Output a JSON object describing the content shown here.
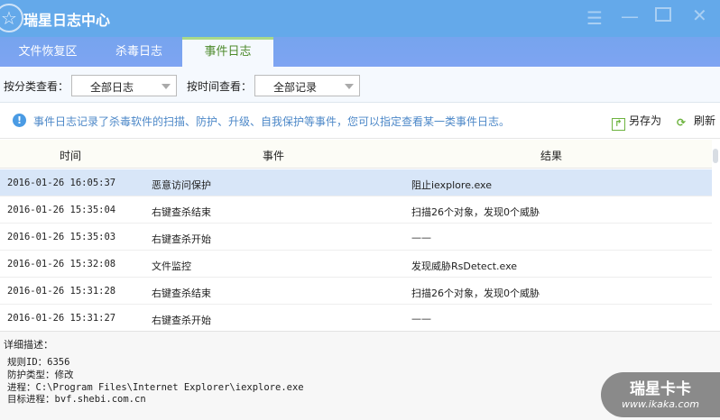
{
  "window": {
    "title": "瑞星日志中心",
    "controls": [
      "menu",
      "minimize",
      "maximize",
      "close"
    ]
  },
  "tabs": [
    {
      "label": "文件恢复区"
    },
    {
      "label": "杀毒日志"
    },
    {
      "label": "事件日志",
      "active": true
    }
  ],
  "filters": {
    "category_label": "按分类查看：",
    "category_value": "全部日志",
    "time_label": "按时间查看：",
    "time_value": "全部记录"
  },
  "info": {
    "text": "事件日志记录了杀毒软件的扫描、防护、升级、自我保护等事件，您可以指定查看某一类事件日志。",
    "save_as": "另存为",
    "refresh": "刷新"
  },
  "table": {
    "headers": [
      "时间",
      "事件",
      "结果"
    ],
    "rows": [
      [
        "2016-01-26 16:05:37",
        "恶意访问保护",
        "阻止iexplore.exe"
      ],
      [
        "2016-01-26 15:35:04",
        "右键查杀结束",
        "扫描26个对象，发现0个威胁"
      ],
      [
        "2016-01-26 15:35:03",
        "右键查杀开始",
        "——"
      ],
      [
        "2016-01-26 15:32:08",
        "文件监控",
        "发现威胁RsDetect.exe"
      ],
      [
        "2016-01-26 15:31:28",
        "右键查杀结束",
        "扫描26个对象，发现0个威胁"
      ],
      [
        "2016-01-26 15:31:27",
        "右键查杀开始",
        "——"
      ]
    ]
  },
  "detail": {
    "title": "详细描述：",
    "lines": [
      "规则ID：6356",
      "防护类型：修改",
      "进程：C:\\Program Files\\Internet Explorer\\iexplore.exe",
      "目标进程：bvf.shebi.com.cn"
    ]
  },
  "watermark": {
    "brand": "瑞星卡卡",
    "url": "www.ikaka.com"
  }
}
